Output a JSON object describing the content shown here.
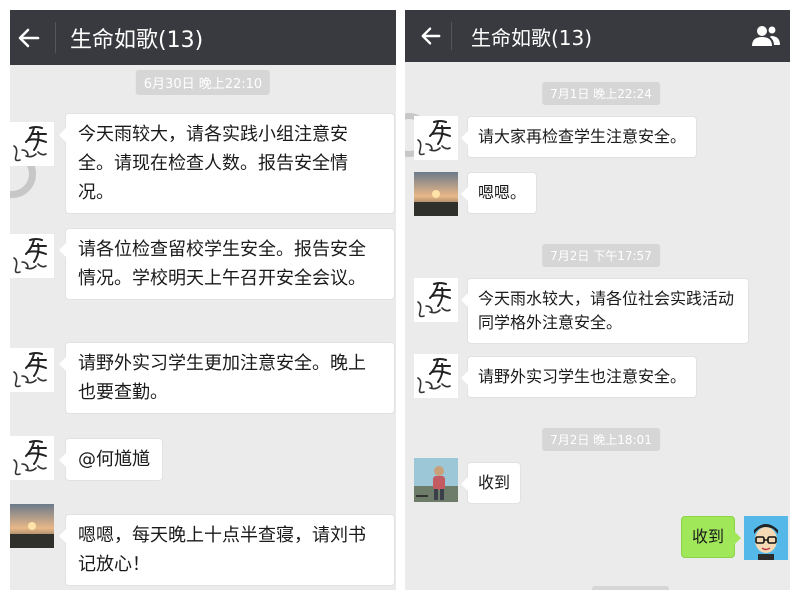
{
  "left": {
    "header": {
      "title": "生命如歌(13)"
    },
    "timestamp": "6月30日 晚上22:10",
    "messages": [
      {
        "text": "今天雨较大，请各实践小组注意安全。请现在检查人数。报告安全情况。"
      },
      {
        "text": "请各位检查留校学生安全。报告安全情况。学校明天上午召开安全会议。"
      },
      {
        "text": "请野外实习学生更加注意安全。晚上也要查勤。"
      },
      {
        "text": "@何馗馗"
      },
      {
        "text": "嗯嗯，每天晚上十点半查寝，请刘书记放心！"
      }
    ]
  },
  "right": {
    "header": {
      "title": "生命如歌(13)"
    },
    "timestamps": [
      "7月1日 晚上22:24",
      "7月2日 下午17:57",
      "7月2日 晚上18:01"
    ],
    "messages": [
      {
        "text": "请大家再检查学生注意安全。"
      },
      {
        "text": "嗯嗯。"
      },
      {
        "text": "今天雨水较大，请各位社会实践活动同学格外注意安全。"
      },
      {
        "text": "请野外实习学生也注意安全。"
      },
      {
        "text": "收到"
      },
      {
        "text": "收到"
      }
    ]
  },
  "icons": {
    "back": "back-arrow-icon",
    "group": "group-members-icon",
    "calligraphy_avatar": "calligraphy-avatar-icon",
    "sunset_avatar": "sunset-photo-avatar",
    "person_avatar": "person-photo-avatar",
    "cartoon_avatar": "cartoon-glasses-avatar"
  },
  "colors": {
    "titlebar": "#393a3f",
    "chat_bg": "#ebebeb",
    "bubble_received": "#ffffff",
    "bubble_sent": "#a0e75a",
    "timestamp_bg": "#d6d6d6"
  }
}
